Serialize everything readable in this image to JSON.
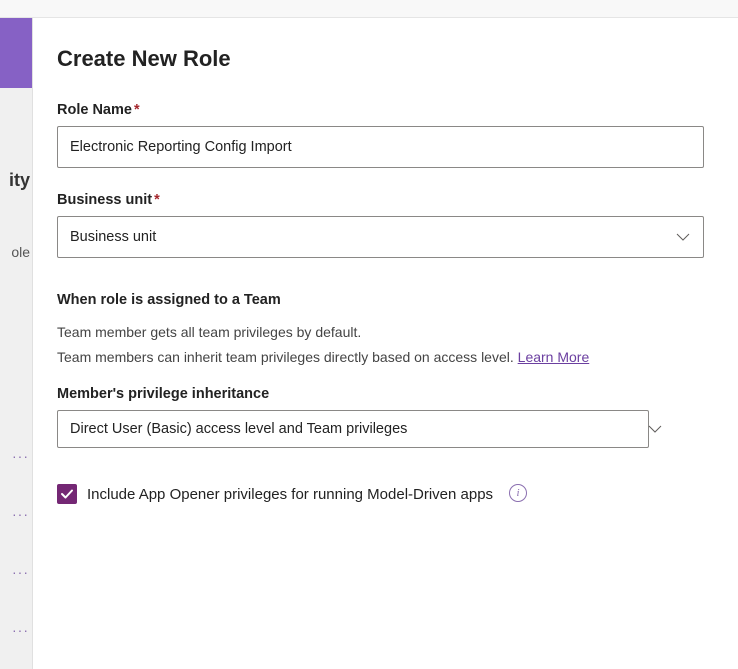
{
  "peek": {
    "line1": "ity",
    "line2": "ole"
  },
  "panel": {
    "title": "Create New Role",
    "role_name_label": "Role Name",
    "role_name_value": "Electronic Reporting Config Import",
    "business_unit_label": "Business unit",
    "business_unit_value": "Business unit",
    "team_section_heading": "When role is assigned to a Team",
    "team_text1": "Team member gets all team privileges by default.",
    "team_text2_a": "Team members can inherit team privileges directly based on access level. ",
    "learn_more": "Learn More",
    "inheritance_label": "Member's privilege inheritance",
    "inheritance_value": "Direct User (Basic) access level and Team privileges",
    "checkbox_label": "Include App Opener privileges for running Model-Driven apps",
    "checkbox_checked": true
  }
}
